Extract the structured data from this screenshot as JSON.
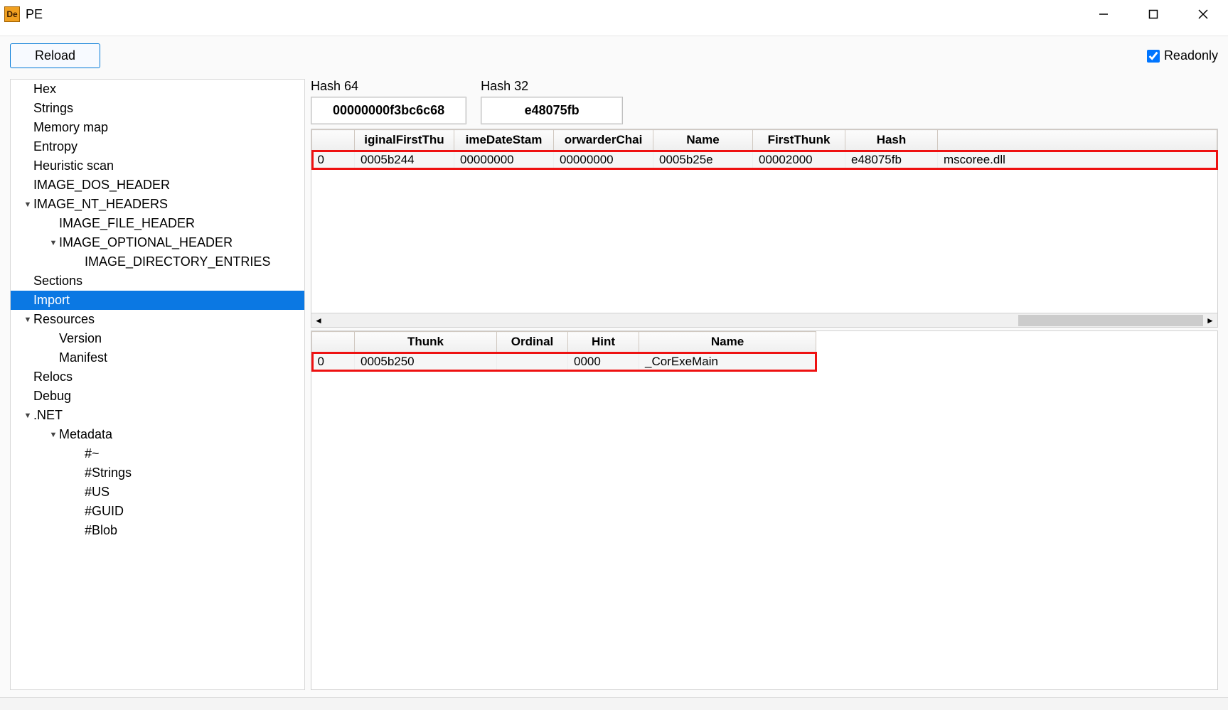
{
  "window": {
    "title": "PE"
  },
  "toolbar": {
    "reload_label": "Reload",
    "readonly_label": "Readonly",
    "readonly_checked": true
  },
  "tree": {
    "items": [
      {
        "label": "Hex",
        "indent": 1,
        "expander": ""
      },
      {
        "label": "Strings",
        "indent": 1,
        "expander": ""
      },
      {
        "label": "Memory map",
        "indent": 1,
        "expander": ""
      },
      {
        "label": "Entropy",
        "indent": 1,
        "expander": ""
      },
      {
        "label": "Heuristic scan",
        "indent": 1,
        "expander": ""
      },
      {
        "label": "IMAGE_DOS_HEADER",
        "indent": 1,
        "expander": ""
      },
      {
        "label": "IMAGE_NT_HEADERS",
        "indent": 1,
        "expander": "▼"
      },
      {
        "label": "IMAGE_FILE_HEADER",
        "indent": 2,
        "expander": ""
      },
      {
        "label": "IMAGE_OPTIONAL_HEADER",
        "indent": 2,
        "expander": "▼"
      },
      {
        "label": "IMAGE_DIRECTORY_ENTRIES",
        "indent": 3,
        "expander": ""
      },
      {
        "label": "Sections",
        "indent": 1,
        "expander": ""
      },
      {
        "label": "Import",
        "indent": 1,
        "expander": "",
        "selected": true
      },
      {
        "label": "Resources",
        "indent": 1,
        "expander": "▼"
      },
      {
        "label": "Version",
        "indent": 2,
        "expander": ""
      },
      {
        "label": "Manifest",
        "indent": 2,
        "expander": ""
      },
      {
        "label": "Relocs",
        "indent": 1,
        "expander": ""
      },
      {
        "label": "Debug",
        "indent": 1,
        "expander": ""
      },
      {
        "label": ".NET",
        "indent": 1,
        "expander": "▼"
      },
      {
        "label": "Metadata",
        "indent": 2,
        "expander": "▼"
      },
      {
        "label": "#~",
        "indent": 3,
        "expander": ""
      },
      {
        "label": "#Strings",
        "indent": 3,
        "expander": ""
      },
      {
        "label": "#US",
        "indent": 3,
        "expander": ""
      },
      {
        "label": "#GUID",
        "indent": 3,
        "expander": ""
      },
      {
        "label": "#Blob",
        "indent": 3,
        "expander": ""
      }
    ]
  },
  "hash": {
    "h64_label": "Hash 64",
    "h64_value": "00000000f3bc6c68",
    "h32_label": "Hash 32",
    "h32_value": "e48075fb"
  },
  "table1": {
    "headers": [
      "",
      "iginalFirstThu",
      "imeDateStam",
      "orwarderChai",
      "Name",
      "FirstThunk",
      "Hash",
      ""
    ],
    "row0": [
      "0",
      "0005b244",
      "00000000",
      "00000000",
      "0005b25e",
      "00002000",
      "e48075fb",
      "mscoree.dll"
    ]
  },
  "table2": {
    "headers": [
      "",
      "Thunk",
      "Ordinal",
      "Hint",
      "Name"
    ],
    "row0": [
      "0",
      "0005b250",
      "",
      "0000",
      "_CorExeMain"
    ]
  }
}
